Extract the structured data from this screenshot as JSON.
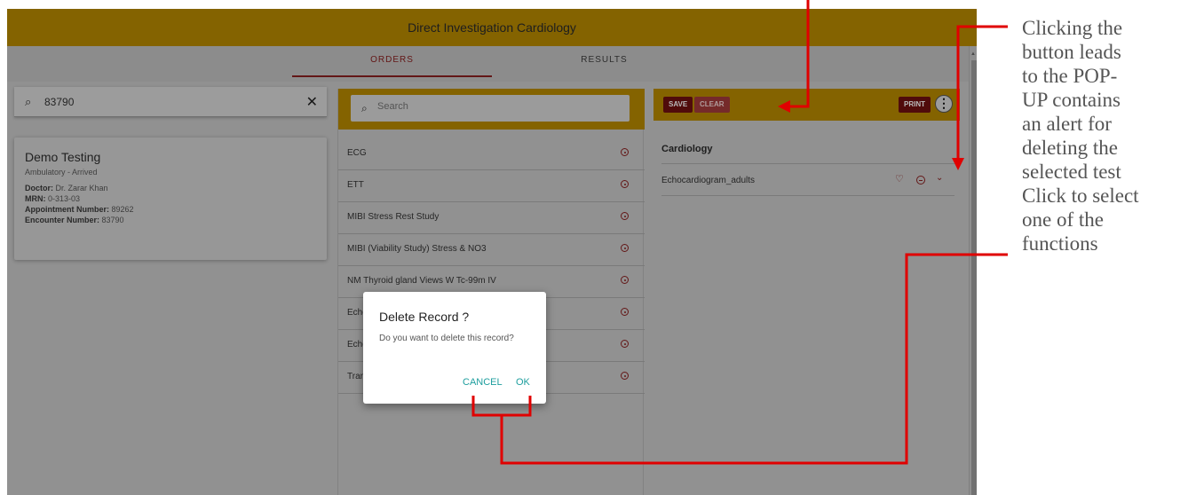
{
  "header": {
    "title": "Direct Investigation Cardiology"
  },
  "tabs": [
    {
      "label": "ORDERS",
      "active": true
    },
    {
      "label": "RESULTS",
      "active": false
    }
  ],
  "patient_search": {
    "value": "83790",
    "search_icon": "search-icon",
    "clear_icon": "close-icon",
    "clear_label": "✕"
  },
  "patient": {
    "name": "Demo Testing",
    "status": "Ambulatory - Arrived",
    "doctor_label": "Doctor:",
    "doctor": "Dr. Zarar Khan",
    "mrn_label": "MRN:",
    "mrn": "0-313-03",
    "appointment_label": "Appointment Number:",
    "appointment": "89262",
    "encounter_label": "Encounter Number:",
    "encounter": "83790"
  },
  "orders": {
    "search_placeholder": "Search",
    "items": [
      {
        "label": "ECG"
      },
      {
        "label": "ETT"
      },
      {
        "label": "MIBI Stress Rest Study"
      },
      {
        "label": "MIBI (Viability Study) Stress & NO3"
      },
      {
        "label": "NM Thyroid gland Views W Tc-99m IV"
      },
      {
        "label": "Echo"
      },
      {
        "label": "Echo"
      },
      {
        "label": "Tran"
      }
    ]
  },
  "selected": {
    "save_label": "SAVE",
    "clear_label": "CLEAR",
    "print_label": "PRINT",
    "more_label": "⋮",
    "category": "Cardiology",
    "item": "Echocardiogram_adults",
    "heart_icon": "♡",
    "chevron_icon": "⌄"
  },
  "dialog": {
    "title": "Delete Record ?",
    "message": "Do you want to delete this record?",
    "cancel_label": "CANCEL",
    "ok_label": "OK"
  },
  "annotations": {
    "text1": [
      "Clicking the",
      "button leads",
      "to the POP-",
      "UP contains",
      "an alert for",
      "deleting the",
      "selected test"
    ],
    "text2": [
      "Click to select",
      "one of the",
      "functions"
    ]
  },
  "colors": {
    "header_bg": "#b88a00",
    "accent_dark_red": "#6f1010",
    "dialog_button": "#1e9e9e",
    "annotation_line": "#e00000"
  }
}
